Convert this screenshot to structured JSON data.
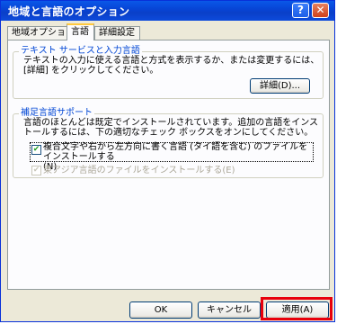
{
  "window": {
    "title": "地域と言語のオプション",
    "help_glyph": "?",
    "close_glyph": "✕"
  },
  "tabs": [
    {
      "label": "地域オプション",
      "active": false
    },
    {
      "label": "言語",
      "active": true
    },
    {
      "label": "詳細設定",
      "active": false
    }
  ],
  "text_services": {
    "title": "テキスト サービスと入力言語",
    "description": "テキストの入力に使える言語と方式を表示するか、または変更するには、[詳細] をクリックしてください。",
    "details_button": "詳細(D)..."
  },
  "supplemental": {
    "title": "補足言語サポート",
    "description": "言語のほとんどは既定でインストールされています。追加の言語をインストールするには、下の適切なチェック ボックスをオンにしてください。",
    "complex_script": {
      "label_line1": "複合文字や右から左方向に書く言語 (タイ語を含む) のファイルをインストールする",
      "label_line2": "(N)",
      "checked": true,
      "enabled": true
    },
    "east_asian": {
      "label": "東アジア言語のファイルをインストールする(E)",
      "checked": true,
      "enabled": false
    }
  },
  "buttons": {
    "ok": "OK",
    "cancel": "キャンセル",
    "apply": "適用(A)"
  },
  "highlight_color": "#e8000b"
}
